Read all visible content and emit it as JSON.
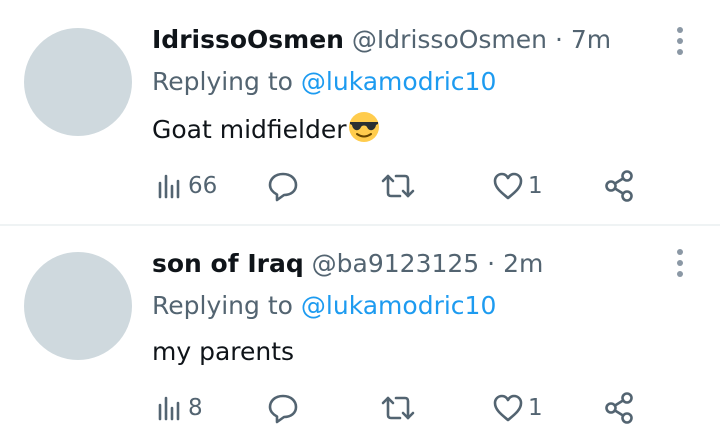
{
  "tweets": [
    {
      "name": "IdrissoOsmen",
      "handle": "@IdrissoOsmen",
      "separator": "·",
      "time": "7m",
      "replying_label": "Replying to",
      "replying_to": "@lukamodric10",
      "text": "Goat midfielder",
      "text_emoji": "smiling-face-with-sunglasses-emoji",
      "views": "66",
      "likes": "1"
    },
    {
      "name": "son of Iraq",
      "handle": "@ba9123125",
      "separator": "·",
      "time": "2m",
      "replying_label": "Replying to",
      "replying_to": "@lukamodric10",
      "text": "my parents",
      "views": "8",
      "likes": "1"
    }
  ],
  "colors": {
    "name": "#0f1419",
    "meta": "#536471",
    "link": "#1d9bf0",
    "avatar": "#cfd9de",
    "divider": "#eff3f4"
  },
  "icons": [
    "views-icon",
    "reply-icon",
    "retweet-icon",
    "like-icon",
    "share-icon",
    "more-options-icon"
  ]
}
